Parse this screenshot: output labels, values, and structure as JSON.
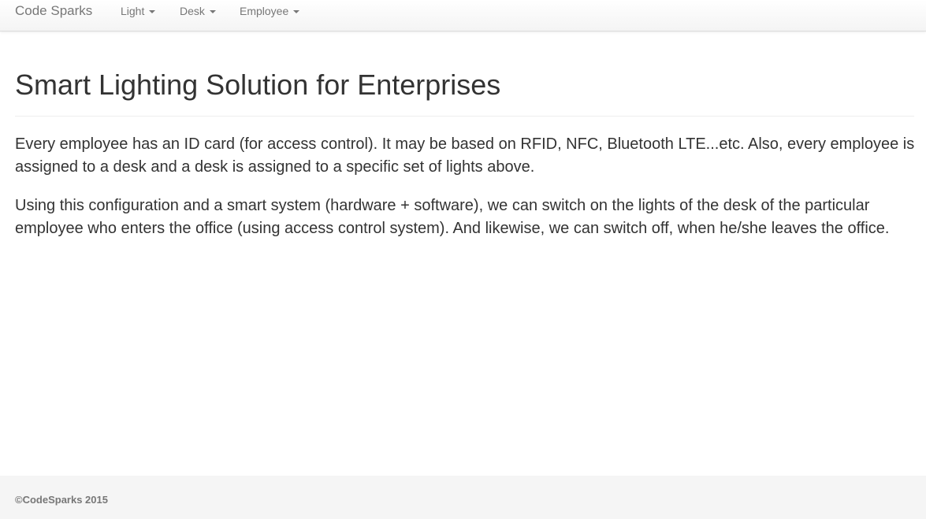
{
  "navbar": {
    "brand": "Code Sparks",
    "items": [
      {
        "label": "Light"
      },
      {
        "label": "Desk"
      },
      {
        "label": "Employee"
      }
    ]
  },
  "main": {
    "title": "Smart Lighting Solution for Enterprises",
    "paragraphs": [
      "Every employee has an ID card (for access control). It may be based on RFID, NFC, Bluetooth LTE...etc. Also, every employee is assigned to a desk and a desk is assigned to a specific set of lights above.",
      "Using this configuration and a smart system (hardware + software), we can switch on the lights of the desk of the particular employee who enters the office (using access control system). And likewise, we can switch off, when he/she leaves the office."
    ]
  },
  "footer": {
    "text": "©CodeSparks 2015"
  }
}
